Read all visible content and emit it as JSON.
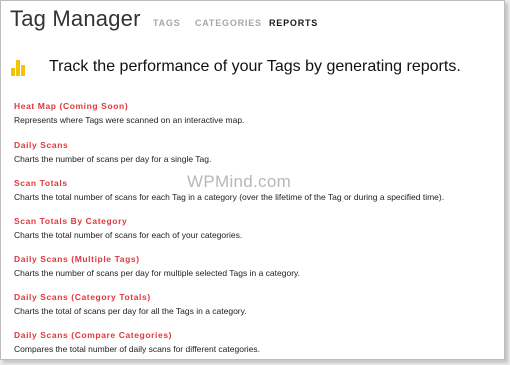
{
  "app": {
    "title": "Tag Manager"
  },
  "nav": {
    "tabs": [
      {
        "label": "TAGS",
        "active": false
      },
      {
        "label": "CATEGORIES",
        "active": false
      },
      {
        "label": "REPORTS",
        "active": true
      }
    ]
  },
  "banner": {
    "icon": "bar-chart-icon",
    "icon_color": "#f2c500",
    "text": "Track the performance of your Tags by generating reports."
  },
  "reports": [
    {
      "title": "Heat Map (Coming Soon)",
      "description": "Represents where Tags were scanned on an interactive map."
    },
    {
      "title": "Daily Scans",
      "description": "Charts the number of scans per day for a single Tag."
    },
    {
      "title": "Scan Totals",
      "description": "Charts the total number of scans for each Tag in a category (over the lifetime of the Tag or during a specified time)."
    },
    {
      "title": "Scan Totals By Category",
      "description": "Charts the total number of scans for each of your categories."
    },
    {
      "title": "Daily Scans (Multiple Tags)",
      "description": "Charts the number of scans per day for multiple selected Tags in a category."
    },
    {
      "title": "Daily Scans (Category Totals)",
      "description": "Charts the total of scans per day for all the Tags in a category."
    },
    {
      "title": "Daily Scans (Compare Categories)",
      "description": "Compares the total number of daily scans for different categories."
    }
  ],
  "colors": {
    "accent": "#e0383c",
    "active_tab": "#1a1a1a",
    "inactive_tab": "#a6a6a6"
  },
  "watermark": {
    "text": "WPMind.com"
  }
}
